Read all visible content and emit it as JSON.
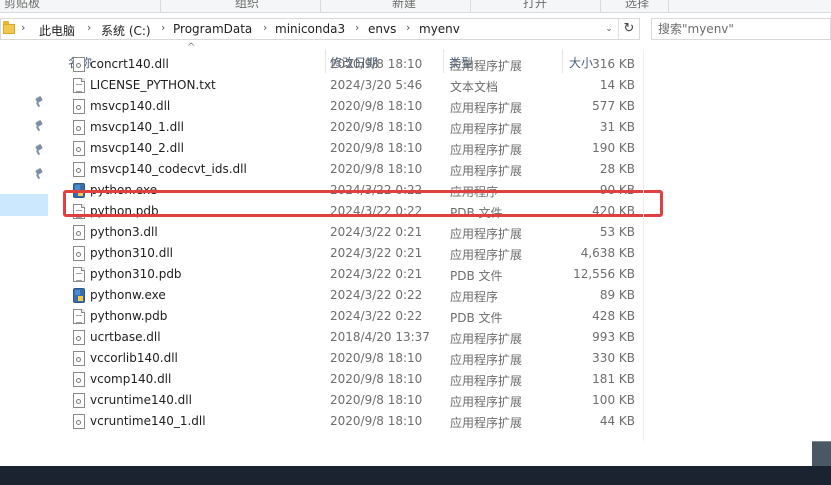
{
  "ribbon": {
    "groups": [
      "剪贴板",
      "组织",
      "新建",
      "打开",
      "选择"
    ]
  },
  "address": {
    "crumbs": [
      "此电脑",
      "系统 (C:)",
      "ProgramData",
      "miniconda3",
      "envs",
      "myenv"
    ],
    "dropdown_glyph": "⌄",
    "refresh_glyph": "↻"
  },
  "search": {
    "placeholder": "搜索\"myenv\""
  },
  "columns": {
    "name": "名称",
    "date": "修改日期",
    "type": "类型",
    "size": "大小",
    "sort_glyph": "^"
  },
  "files": [
    {
      "name": "concrt140.dll",
      "date": "2020/9/8 18:10",
      "type": "应用程序扩展",
      "size": "316 KB",
      "icon": "dll-icon"
    },
    {
      "name": "LICENSE_PYTHON.txt",
      "date": "2024/3/20 5:46",
      "type": "文本文档",
      "size": "14 KB",
      "icon": "text-file-icon"
    },
    {
      "name": "msvcp140.dll",
      "date": "2020/9/8 18:10",
      "type": "应用程序扩展",
      "size": "577 KB",
      "icon": "dll-icon"
    },
    {
      "name": "msvcp140_1.dll",
      "date": "2020/9/8 18:10",
      "type": "应用程序扩展",
      "size": "31 KB",
      "icon": "dll-icon"
    },
    {
      "name": "msvcp140_2.dll",
      "date": "2020/9/8 18:10",
      "type": "应用程序扩展",
      "size": "190 KB",
      "icon": "dll-icon"
    },
    {
      "name": "msvcp140_codecvt_ids.dll",
      "date": "2020/9/8 18:10",
      "type": "应用程序扩展",
      "size": "28 KB",
      "icon": "dll-icon"
    },
    {
      "name": "python.exe",
      "date": "2024/3/22 0:22",
      "type": "应用程序",
      "size": "90 KB",
      "icon": "python-exe-icon"
    },
    {
      "name": "python.pdb",
      "date": "2024/3/22 0:22",
      "type": "PDB 文件",
      "size": "420 KB",
      "icon": "file-icon"
    },
    {
      "name": "python3.dll",
      "date": "2024/3/22 0:21",
      "type": "应用程序扩展",
      "size": "53 KB",
      "icon": "dll-icon"
    },
    {
      "name": "python310.dll",
      "date": "2024/3/22 0:21",
      "type": "应用程序扩展",
      "size": "4,638 KB",
      "icon": "dll-icon"
    },
    {
      "name": "python310.pdb",
      "date": "2024/3/22 0:21",
      "type": "PDB 文件",
      "size": "12,556 KB",
      "icon": "file-icon"
    },
    {
      "name": "pythonw.exe",
      "date": "2024/3/22 0:22",
      "type": "应用程序",
      "size": "89 KB",
      "icon": "python-exe-icon"
    },
    {
      "name": "pythonw.pdb",
      "date": "2024/3/22 0:22",
      "type": "PDB 文件",
      "size": "428 KB",
      "icon": "file-icon"
    },
    {
      "name": "ucrtbase.dll",
      "date": "2018/4/20 13:37",
      "type": "应用程序扩展",
      "size": "993 KB",
      "icon": "dll-icon"
    },
    {
      "name": "vccorlib140.dll",
      "date": "2020/9/8 18:10",
      "type": "应用程序扩展",
      "size": "330 KB",
      "icon": "dll-icon"
    },
    {
      "name": "vcomp140.dll",
      "date": "2020/9/8 18:10",
      "type": "应用程序扩展",
      "size": "181 KB",
      "icon": "dll-icon"
    },
    {
      "name": "vcruntime140.dll",
      "date": "2020/9/8 18:10",
      "type": "应用程序扩展",
      "size": "100 KB",
      "icon": "dll-icon"
    },
    {
      "name": "vcruntime140_1.dll",
      "date": "2020/9/8 18:10",
      "type": "应用程序扩展",
      "size": "44 KB",
      "icon": "dll-icon"
    }
  ],
  "highlighted_file": "python.exe",
  "colors": {
    "highlight_border": "#e04040",
    "nav_selected": "#cce8ff",
    "header_text": "#4c607a"
  }
}
